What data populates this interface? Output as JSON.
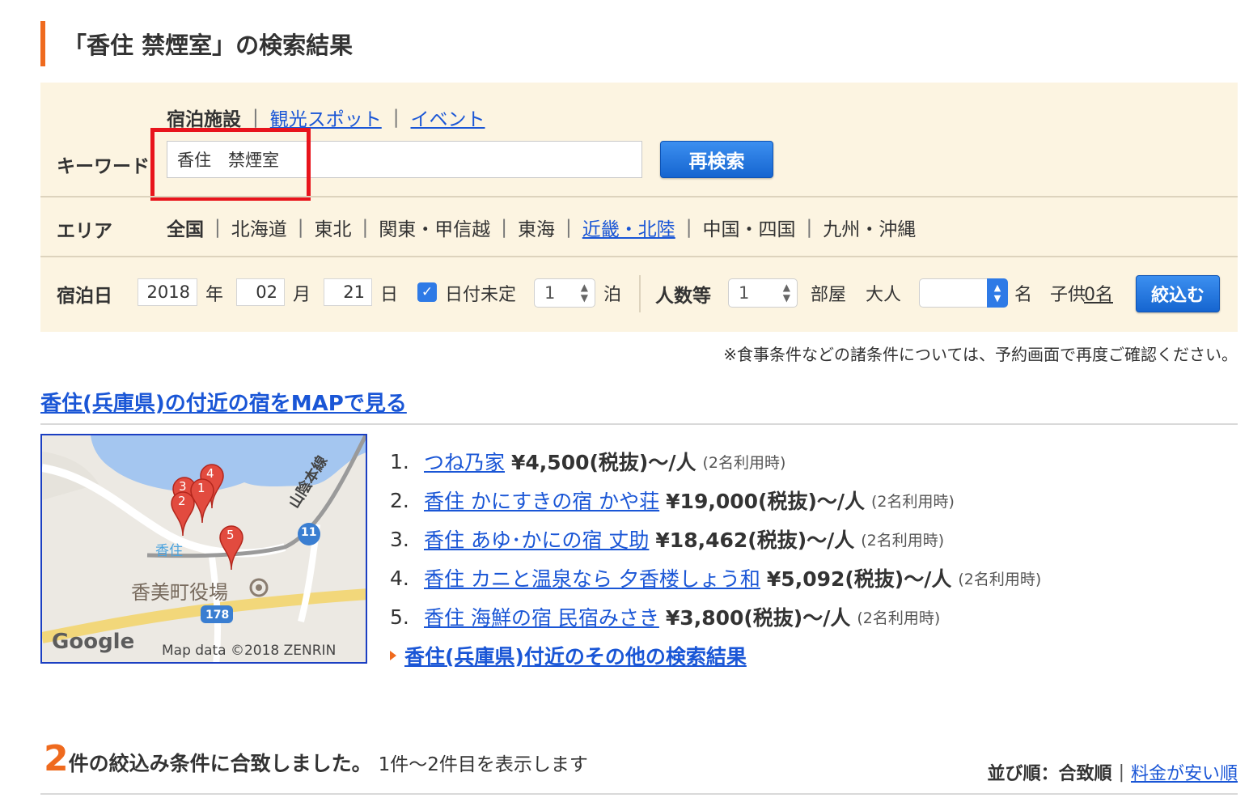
{
  "title": "「香住 禁煙室」の検索結果",
  "search": {
    "category_tabs": [
      {
        "label": "宿泊施設",
        "active": true
      },
      {
        "label": "観光スポット",
        "active": false
      },
      {
        "label": "イベント",
        "active": false
      }
    ],
    "keyword_label": "キーワード",
    "keyword_value": "香住　禁煙室",
    "research_button": "再検索",
    "area_label": "エリア",
    "areas": [
      {
        "label": "全国",
        "active": true,
        "link": false
      },
      {
        "label": "北海道",
        "link": false
      },
      {
        "label": "東北",
        "link": false
      },
      {
        "label": "関東・甲信越",
        "link": false
      },
      {
        "label": "東海",
        "link": false
      },
      {
        "label": "近畿・北陸",
        "link": true
      },
      {
        "label": "中国・四国",
        "link": false
      },
      {
        "label": "九州・沖縄",
        "link": false
      }
    ],
    "stay_date_label": "宿泊日",
    "year": "2018",
    "year_unit": "年",
    "month": "02",
    "month_unit": "月",
    "day": "21",
    "day_unit": "日",
    "date_undecided_label": "日付未定",
    "date_undecided_checked": true,
    "nights": "1",
    "nights_unit": "泊",
    "guests_label": "人数等",
    "rooms": "1",
    "rooms_unit": "部屋",
    "adults_label": "大人",
    "adults": "",
    "adults_unit": "名",
    "children_label": "子供",
    "children_link": "0名",
    "filter_button": "絞込む"
  },
  "note": "※食事条件などの諸条件については、予約画面で再度ご確認ください。",
  "map_link": "香住(兵庫県)の付近の宿をMAPで見る",
  "map": {
    "labels": {
      "station": "香住",
      "townhall": "香美町役場",
      "railway": "山陰本線",
      "route11": "11",
      "route178": "178",
      "google": "Google",
      "attribution": "Map data ©2018 ZENRIN"
    },
    "markers": [
      "4",
      "3",
      "1",
      "2",
      "5"
    ]
  },
  "hotels": [
    {
      "num": "1.",
      "name": "つね乃家",
      "price": "¥4,500(税抜)～/人",
      "note": "(2名利用時)"
    },
    {
      "num": "2.",
      "name": "香住 かにすきの宿 かや荘",
      "price": "¥19,000(税抜)～/人",
      "note": "(2名利用時)"
    },
    {
      "num": "3.",
      "name": "香住 あゆ･かにの宿 丈助",
      "price": "¥18,462(税抜)～/人",
      "note": "(2名利用時)"
    },
    {
      "num": "4.",
      "name": "香住 カニと温泉なら 夕香楼しょう和",
      "price": "¥5,092(税抜)～/人",
      "note": "(2名利用時)"
    },
    {
      "num": "5.",
      "name": "香住 海鮮の宿 民宿みさき",
      "price": "¥3,800(税抜)～/人",
      "note": "(2名利用時)"
    }
  ],
  "more_link": "香住(兵庫県)付近のその他の検索結果",
  "results": {
    "count": "2",
    "text": "件の絞込み条件に合致しました。",
    "range": "1件～2件目を表示します"
  },
  "sort": {
    "label": "並び順：",
    "current": "合致順",
    "separator": "|",
    "alt": "料金が安い順"
  },
  "colors": {
    "accent": "#ef6a1e",
    "link": "#1a56d6",
    "panel": "#fcf4e1",
    "highlight": "#e8141c"
  }
}
